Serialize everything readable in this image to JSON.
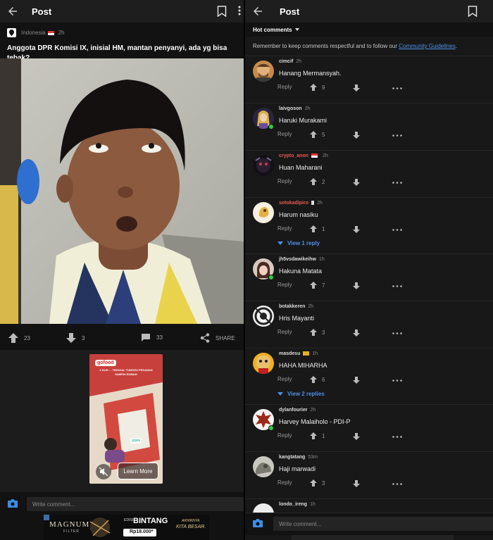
{
  "left": {
    "header": {
      "title": "Post"
    },
    "post": {
      "community": "Indonesia",
      "age": "2h",
      "title": "Anggota DPR Komisi IX, inisial HM, mantan penyanyi, ada yg bisa tebak?",
      "upvotes": "23",
      "downvotes": "3",
      "comments": "33",
      "share_label": "SHARE"
    },
    "ad": {
      "brand": "gofood",
      "tagline": "2 KLIK ... TINGGAL TUNGGU PESANAN SAMPAI RUMAH",
      "cta": "Learn More",
      "partner": "gojek"
    },
    "compose": {
      "placeholder": "Write comment..."
    },
    "banner": {
      "brand": "MAGNUM",
      "sub": "FILTER",
      "edition": "EDISI",
      "title": "BINTANG",
      "price": "Rp18.000*",
      "slogan_1": "AKHIRNYA",
      "slogan_2": "KITA BESAR."
    }
  },
  "right": {
    "header": {
      "title": "Post"
    },
    "sort_label": "Hot comments",
    "guidelines_prefix": "Remember to keep comments respectful and to follow our ",
    "guidelines_link": "Community Guidelines",
    "guidelines_suffix": ".",
    "reply_label": "Reply",
    "comments": [
      {
        "user": "cimcif",
        "time": "2h",
        "text": "Hanang Mermansyah.",
        "votes": "9"
      },
      {
        "user": "laivgoson",
        "time": "2h",
        "text": "Haruki Murakami",
        "votes": "5"
      },
      {
        "user": "crypto_anon",
        "time": "2h",
        "text": "Huan Maharani",
        "votes": "2"
      },
      {
        "user": "sotokadipiro",
        "time": "2h",
        "text": "Harum nasiku",
        "votes": "1",
        "view_replies": "View 1 reply"
      },
      {
        "user": "jh5vsdawikeihw",
        "time": "1h",
        "text": "Hakuna Matata",
        "votes": "7"
      },
      {
        "user": "botakkeren",
        "time": "2h",
        "text": "Hris Mayanti",
        "votes": "3"
      },
      {
        "user": "masdesu",
        "time": "1h",
        "text": "HAHA MIHARHA",
        "votes": "6",
        "view_replies": "View 2 replies"
      },
      {
        "user": "dylanfourier",
        "time": "2h",
        "text": "Harvey Malaiholo - PDI-P",
        "votes": "1"
      },
      {
        "user": "kangtatang",
        "time": "53m",
        "text": "Haji marwadi",
        "votes": "3"
      },
      {
        "user": "londo_ireng",
        "time": "1h"
      }
    ],
    "compose": {
      "placeholder": "Write comment..."
    }
  },
  "colors": {
    "accent_blue": "#4f8fe8",
    "online_green": "#2ecc40",
    "username_red": "#e85a4f"
  }
}
